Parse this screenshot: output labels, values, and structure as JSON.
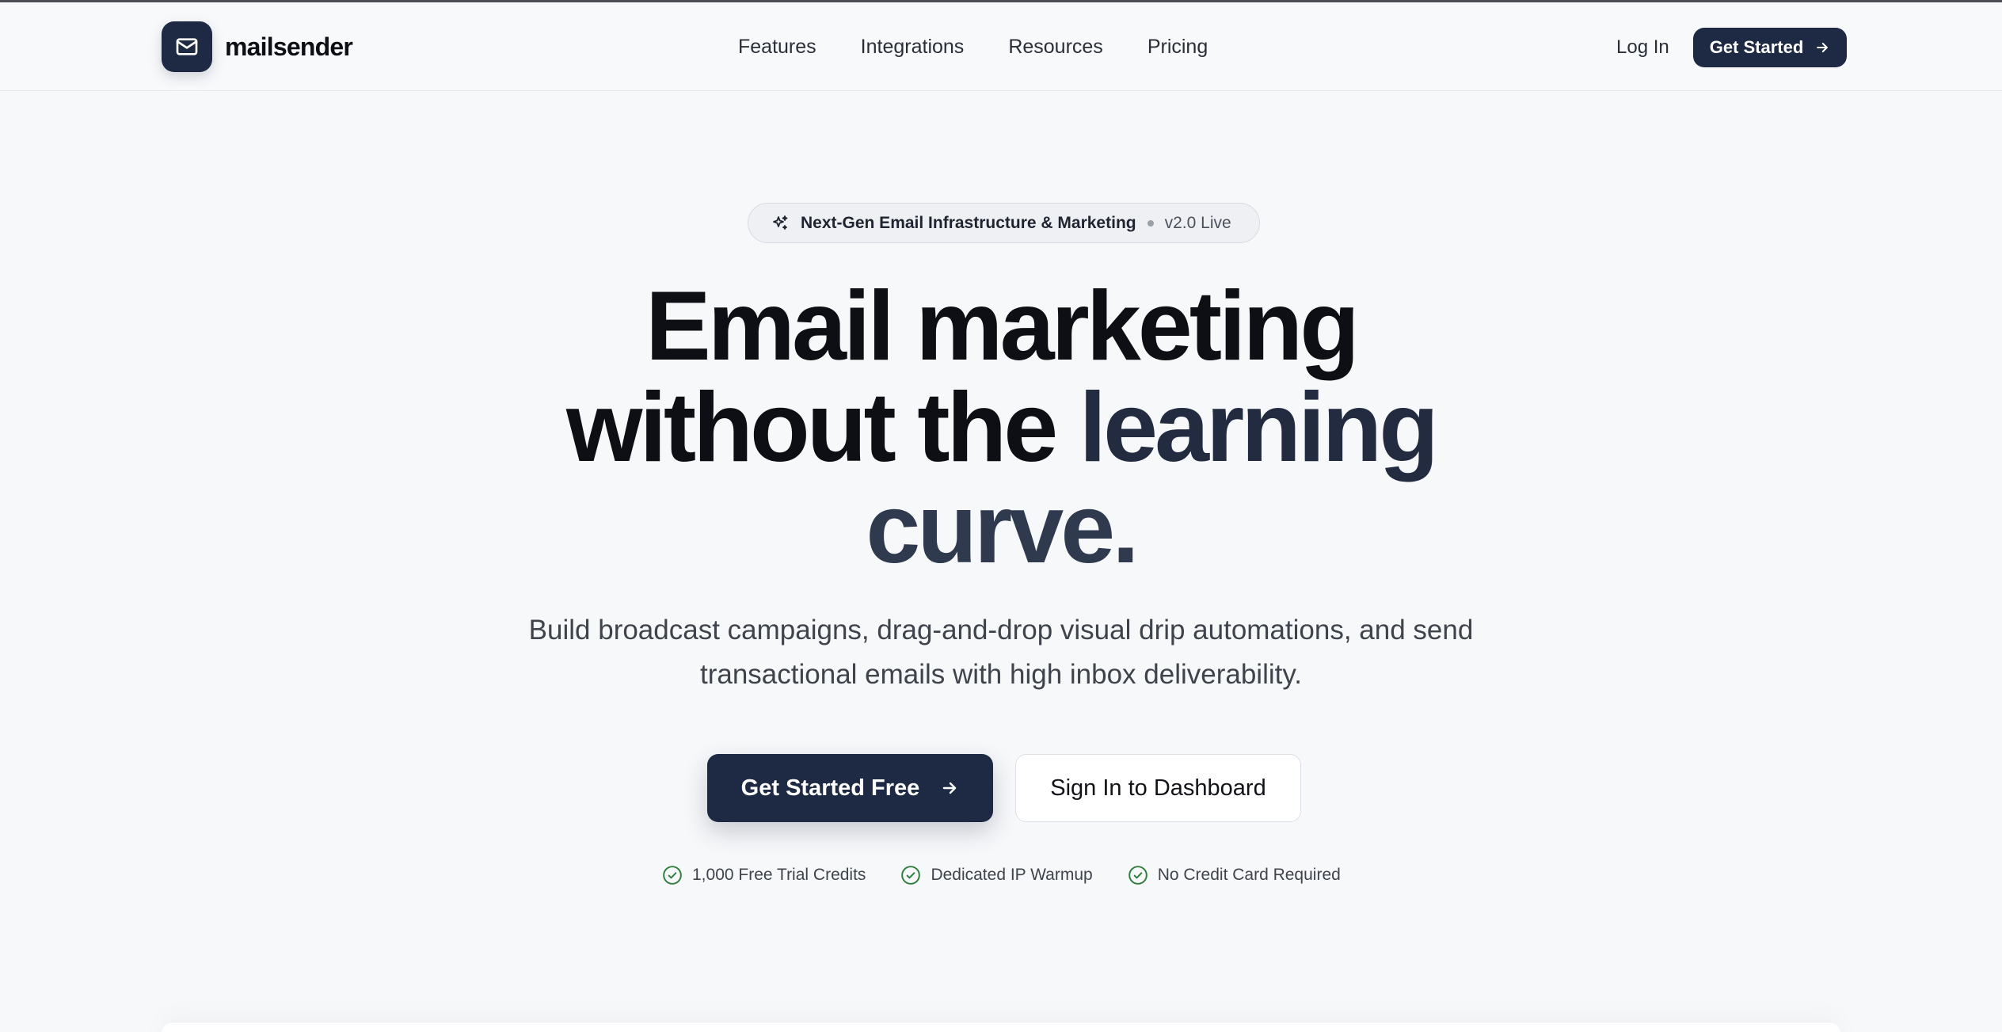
{
  "header": {
    "brand": "mailsender",
    "nav": [
      "Features",
      "Integrations",
      "Resources",
      "Pricing"
    ],
    "login": "Log In",
    "cta": "Get Started"
  },
  "hero": {
    "badge": {
      "title": "Next-Gen Email Infrastructure & Marketing",
      "version": "v2.0 Live"
    },
    "title_line1": "Email marketing",
    "title_line2_a": "without the ",
    "title_line2_b": "learning",
    "title_line3": "curve.",
    "subtitle": "Build broadcast campaigns, drag-and-drop visual drip automations, and send transactional emails with high inbox deliverability.",
    "primary_cta": "Get Started Free",
    "secondary_cta": "Sign In to Dashboard",
    "features": [
      "1,000 Free Trial Credits",
      "Dedicated IP Warmup",
      "No Credit Card Required"
    ]
  },
  "colors": {
    "brand": "#1e2a44",
    "check": "#2f7d3c",
    "background": "#f7f8fa"
  },
  "icons": {
    "logo": "mail-icon",
    "badge": "sparkles-icon",
    "cta": "arrow-right-icon",
    "feature": "check-circle-icon"
  }
}
